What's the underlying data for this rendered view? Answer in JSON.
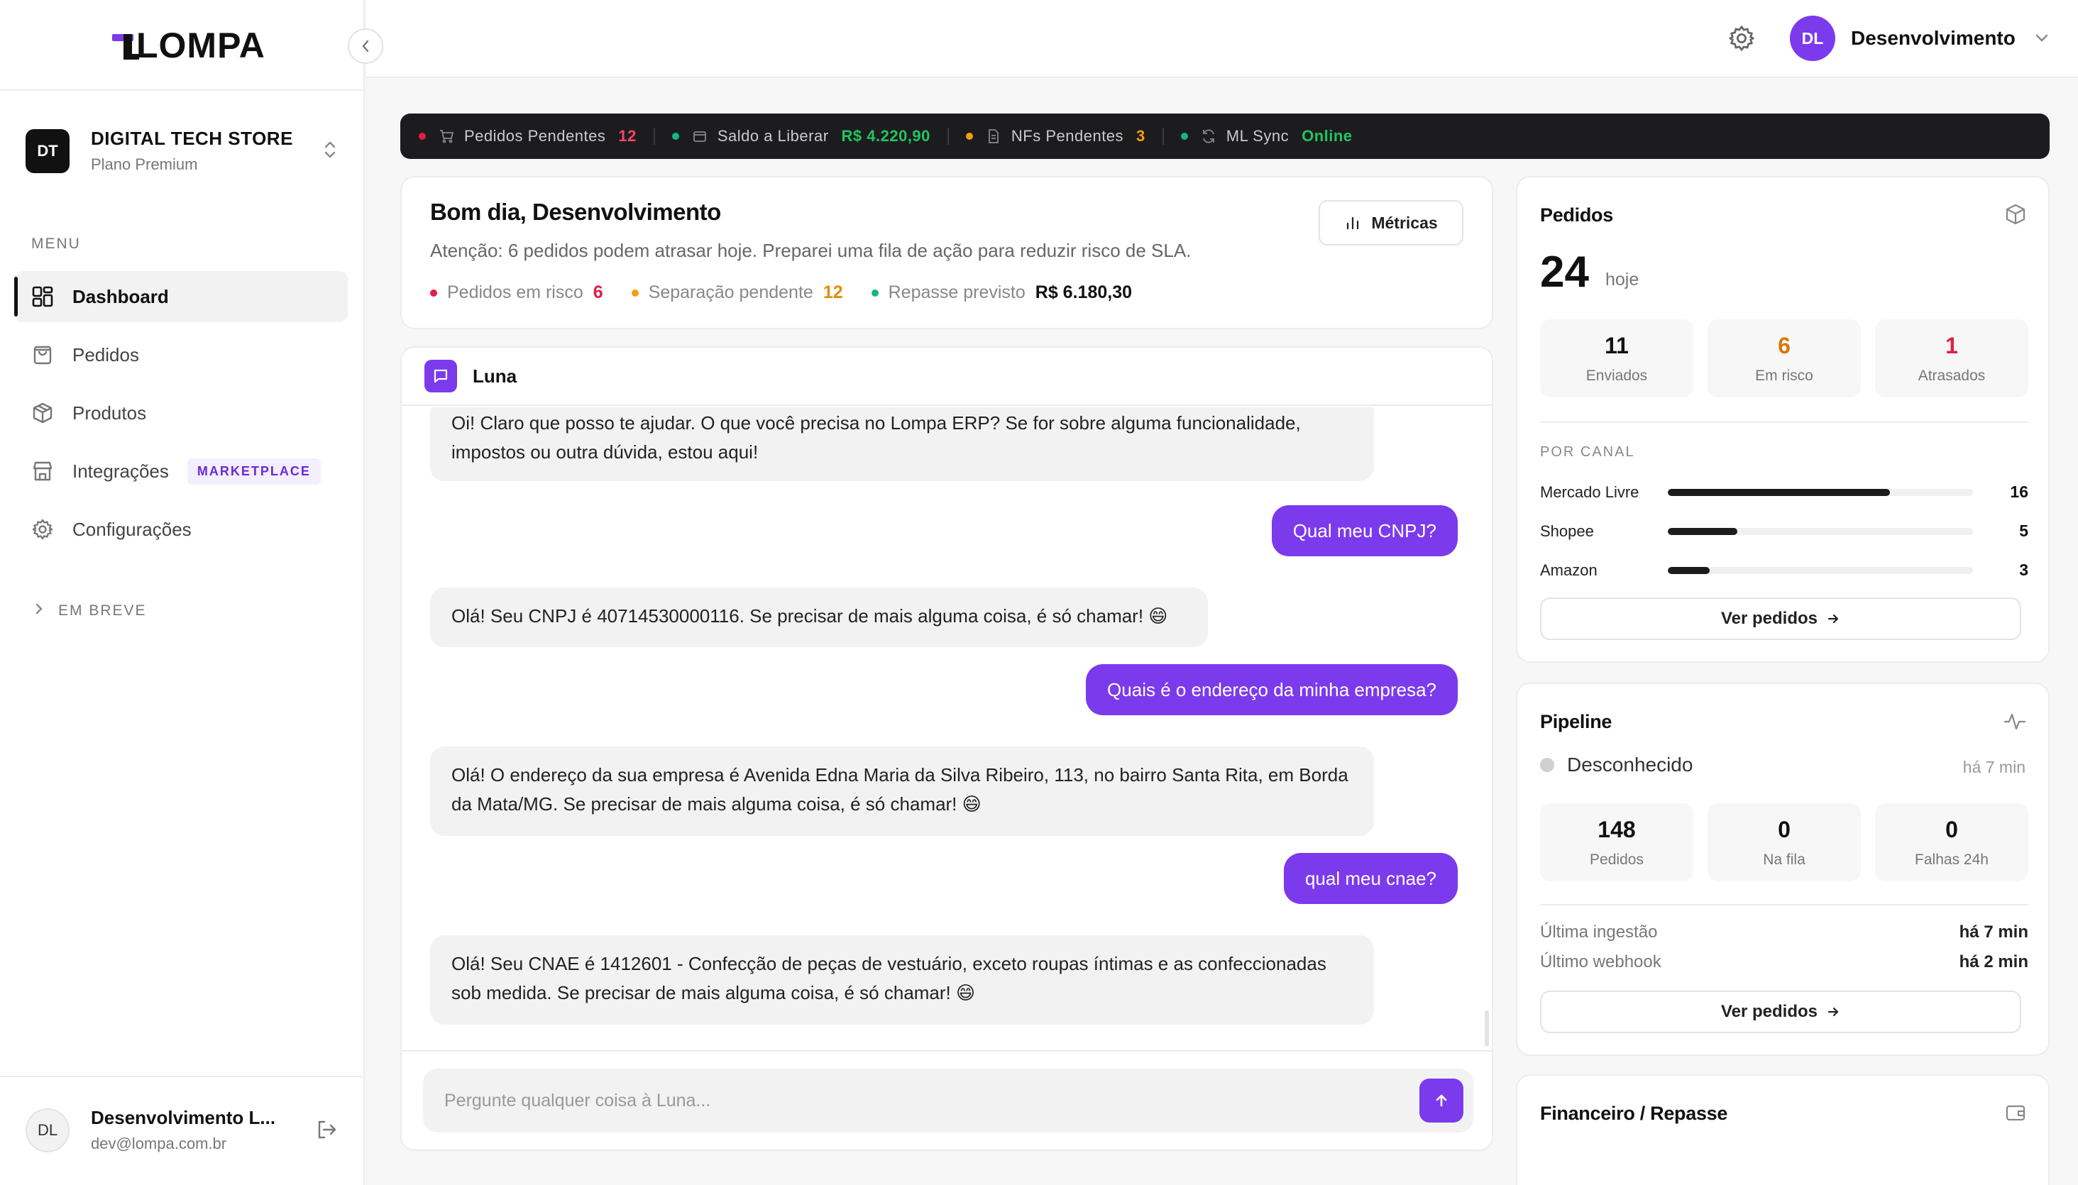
{
  "brand": {
    "name": "LOMPA"
  },
  "store": {
    "initials": "DT",
    "name": "DIGITAL TECH STORE",
    "plan": "Plano Premium"
  },
  "sidebar": {
    "menu_label": "MENU",
    "items": [
      {
        "label": "Dashboard",
        "icon": "dashboard-icon",
        "active": true
      },
      {
        "label": "Pedidos",
        "icon": "shopping-bag-icon"
      },
      {
        "label": "Produtos",
        "icon": "box-icon"
      },
      {
        "label": "Integrações",
        "icon": "store-icon",
        "badge": "MARKETPLACE"
      },
      {
        "label": "Configurações",
        "icon": "gear-icon"
      }
    ],
    "em_breve": "EM BREVE"
  },
  "user": {
    "initials": "DL",
    "name": "Desenvolvimento L...",
    "email": "dev@lompa.com.br"
  },
  "topbar": {
    "user_initials": "DL",
    "user_name": "Desenvolvimento"
  },
  "status_bar": [
    {
      "label": "Pedidos Pendentes",
      "value": "12",
      "dot": "#e11d48",
      "value_color": "#f0466b",
      "icon": "cart-icon"
    },
    {
      "label": "Saldo a Liberar",
      "value": "R$ 4.220,90",
      "dot": "#10b981",
      "value_color": "#22c55e",
      "icon": "wallet-icon"
    },
    {
      "label": "NFs Pendentes",
      "value": "3",
      "dot": "#f59e0b",
      "value_color": "#f59e0b",
      "icon": "file-icon"
    },
    {
      "label": "ML Sync",
      "value": "Online",
      "dot": "#10b981",
      "value_color": "#22c55e",
      "icon": "sync-icon"
    }
  ],
  "greeting": {
    "title": "Bom dia, Desenvolvimento",
    "subtitle": "Atenção: 6 pedidos podem atrasar hoje. Preparei uma fila de ação para reduzir risco de SLA.",
    "metrics_button": "Métricas",
    "stats": [
      {
        "label": "Pedidos em risco",
        "value": "6",
        "dot": "#e11d48",
        "value_color": "#e11d48"
      },
      {
        "label": "Separação pendente",
        "value": "12",
        "dot": "#f59e0b",
        "value_color": "#ea8a0c"
      },
      {
        "label": "Repasse previsto",
        "value": "R$ 6.180,30",
        "dot": "#10b981",
        "value_color": "#111111"
      }
    ]
  },
  "chat": {
    "title": "Luna",
    "messages": [
      {
        "from": "bot",
        "text": "Oi! Claro que posso te ajudar. O que você precisa no Lompa ERP? Se for sobre alguma funcionalidade, impostos ou outra dúvida, estou aqui!"
      },
      {
        "from": "user",
        "text": "Qual meu CNPJ?"
      },
      {
        "from": "bot",
        "text": "Olá! Seu CNPJ é 40714530000116. Se precisar de mais alguma coisa, é só chamar! 😄"
      },
      {
        "from": "user",
        "text": "Quais é o endereço da minha empresa?"
      },
      {
        "from": "bot",
        "text": "Olá! O endereço da sua empresa é Avenida Edna Maria da Silva Ribeiro, 113, no bairro Santa Rita, em Borda da Mata/MG. Se precisar de mais alguma coisa, é só chamar! 😄"
      },
      {
        "from": "user",
        "text": "qual meu cnae?"
      },
      {
        "from": "bot",
        "text": "Olá! Seu CNAE é 1412601 - Confecção de peças de vestuário, exceto roupas íntimas e as confeccionadas sob medida. Se precisar de mais alguma coisa, é só chamar! 😄"
      }
    ],
    "input_placeholder": "Pergunte qualquer coisa à Luna..."
  },
  "pedidos": {
    "title": "Pedidos",
    "total": "24",
    "total_label": "hoje",
    "tiles": [
      {
        "value": "11",
        "label": "Enviados",
        "color": "#111111"
      },
      {
        "value": "6",
        "label": "Em risco",
        "color": "#d97706"
      },
      {
        "value": "1",
        "label": "Atrasados",
        "color": "#e11d48"
      }
    ],
    "por_canal_label": "POR CANAL",
    "channels": [
      {
        "name": "Mercado Livre",
        "value": 16
      },
      {
        "name": "Shopee",
        "value": 5
      },
      {
        "name": "Amazon",
        "value": 3
      }
    ],
    "button": "Ver pedidos"
  },
  "pipeline": {
    "title": "Pipeline",
    "status": "Desconhecido",
    "status_time": "há 7 min",
    "tiles": [
      {
        "value": "148",
        "label": "Pedidos"
      },
      {
        "value": "0",
        "label": "Na fila"
      },
      {
        "value": "0",
        "label": "Falhas 24h"
      }
    ],
    "rows": [
      {
        "label": "Última ingestão",
        "value": "há 7 min"
      },
      {
        "label": "Último webhook",
        "value": "há 2 min"
      }
    ],
    "button": "Ver pedidos"
  },
  "financeiro": {
    "title": "Financeiro / Repasse"
  }
}
